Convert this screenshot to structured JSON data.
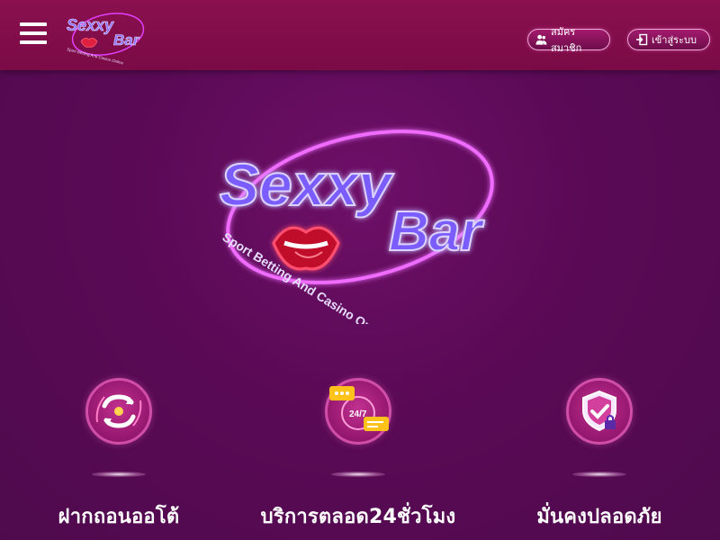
{
  "header": {
    "register_label": "สมัครสมาชิก",
    "login_label": "เข้าสู่ระบบ"
  },
  "brand": {
    "name_line1": "Sexxy",
    "name_line2": "Bar",
    "tagline": "Sport Betting And Casino Online",
    "accent": "#e040fb",
    "header_bg": "#7a0b45",
    "page_bg": "#5a0a55"
  },
  "features": [
    {
      "label": "ฝากถอนออโต้",
      "icon": "auto-exchange-icon"
    },
    {
      "label": "บริการตลอด24ชั่วโมง",
      "icon": "24-7-chat-icon"
    },
    {
      "label": "มั่นคงปลอดภัย",
      "icon": "shield-check-icon"
    }
  ]
}
